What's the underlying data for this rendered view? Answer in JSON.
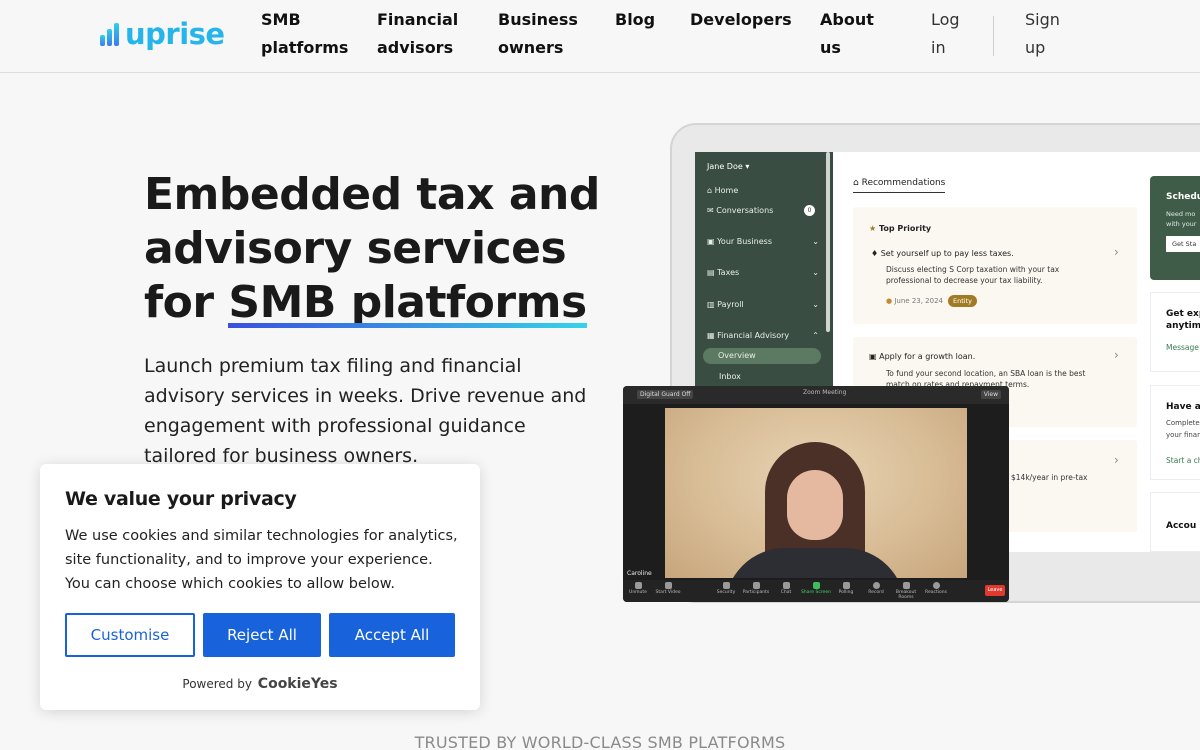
{
  "brand": {
    "name": "uprise",
    "color": "#26b5ea"
  },
  "nav": {
    "items": [
      "SMB platforms",
      "Financial advisors",
      "Business owners",
      "Blog",
      "Developers",
      "About us"
    ],
    "login": "Log in",
    "signup": "Sign up"
  },
  "hero": {
    "title_line1": "Embedded tax and",
    "title_line2": "advisory services",
    "title_line3_pre": "for ",
    "title_line3_highlight": "SMB platforms",
    "description": "Launch premium tax filing and financial advisory services in weeks. Drive revenue and engagement with professional guidance tailored for business owners."
  },
  "mockup": {
    "user": "Jane Doe",
    "sidebar": [
      {
        "label": "Home"
      },
      {
        "label": "Conversations",
        "count": "0"
      },
      {
        "label": "Your Business"
      },
      {
        "label": "Taxes"
      },
      {
        "label": "Payroll"
      },
      {
        "label": "Financial Advisory"
      },
      {
        "label": "Overview"
      },
      {
        "label": "Inbox"
      }
    ],
    "tab": "Recommendations",
    "top_priority": "Top Priority",
    "rec1_title": "Set yourself up to pay less taxes.",
    "rec1_text": "Discuss electing S Corp taxation with your tax professional to decrease your tax liability.",
    "rec1_date": "June 23, 2024",
    "rec1_tag": "Entity",
    "rec2_title": "Apply for a growth loan.",
    "rec2_text": "To fund your second location, an SBA loan is the best match on rates and repayment terms.",
    "rec3_text": "$14k/year in pre-tax",
    "right_cards": [
      {
        "title": "Schedu",
        "sub": "Need mo",
        "sub2": "with your",
        "link": "Get Sta"
      },
      {
        "title": "Get exp",
        "sub": "anytime",
        "link": "Message"
      },
      {
        "title": "Have a",
        "sub": "Complete",
        "sub2": "your financ",
        "link": "Start a ch"
      },
      {
        "title": "Accou"
      }
    ],
    "video": {
      "badge": "Digital Guard Off",
      "title": "Zoom Meeting",
      "view": "View",
      "participant": "Caroline",
      "controls": [
        "Unmute",
        "Start Video",
        "Security",
        "Participants",
        "Chat",
        "Share Screen",
        "Polling",
        "Record",
        "Breakout Rooms",
        "Reactions"
      ],
      "leave": "Leave"
    }
  },
  "cookie": {
    "title": "We value your privacy",
    "text": "We use cookies and similar technologies for analytics, site functionality, and to improve your experience. You can choose which cookies to allow below.",
    "customise": "Customise",
    "reject": "Reject All",
    "accept": "Accept All",
    "powered_by": "Powered by",
    "powered_brand": "CookieYes",
    "accent": "#1863dc"
  },
  "trusted": "TRUSTED BY WORLD-CLASS SMB PLATFORMS"
}
